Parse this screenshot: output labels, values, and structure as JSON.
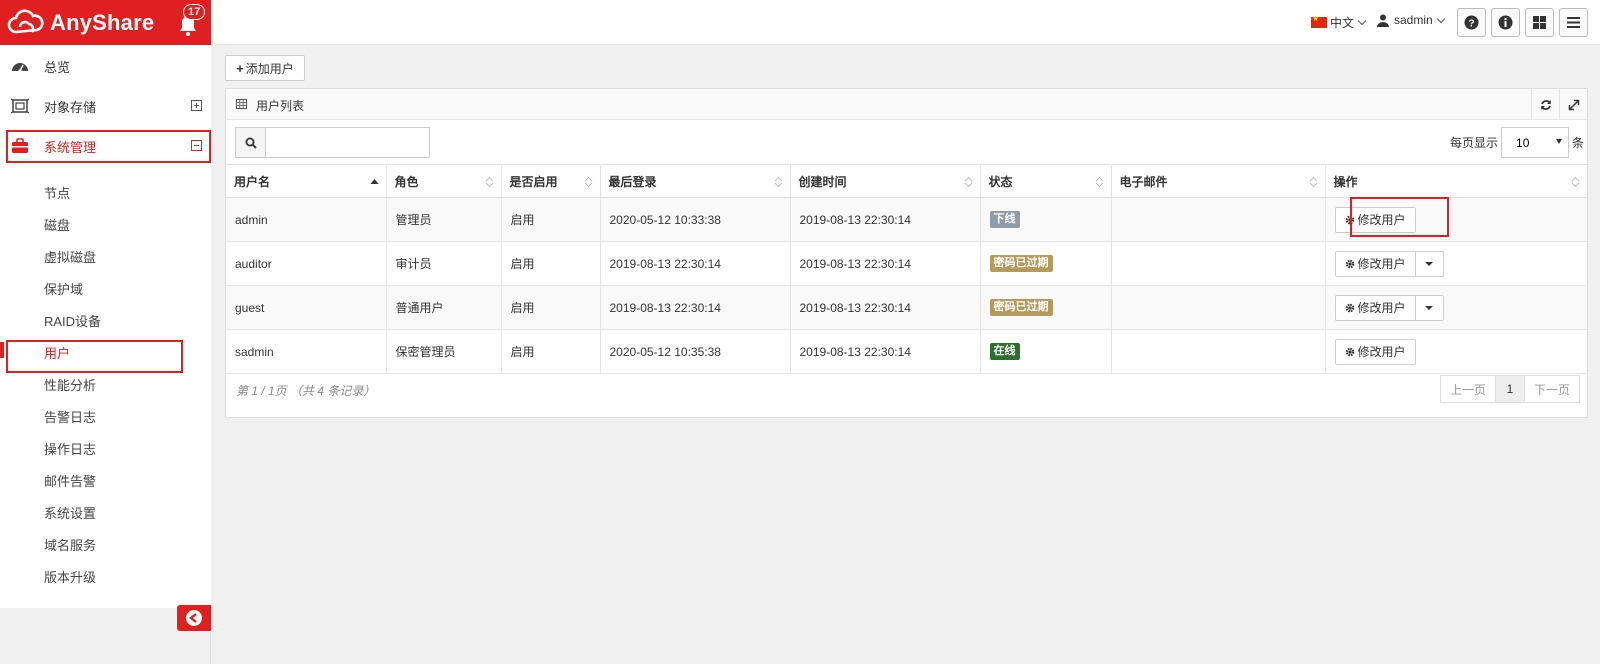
{
  "brand": {
    "name": "AnyShare",
    "notification_count": "17"
  },
  "topbar": {
    "language": "中文",
    "username": "sadmin",
    "buttons": [
      "help-icon",
      "info-icon",
      "grid-icon",
      "menu-icon"
    ]
  },
  "sidebar": {
    "items": [
      {
        "label": "总览",
        "icon": "dashboard-icon"
      },
      {
        "label": "对象存储",
        "icon": "storage-icon",
        "expand": "plus"
      },
      {
        "label": "系统管理",
        "icon": "briefcase-icon",
        "expand": "minus"
      }
    ],
    "sub_items": [
      "节点",
      "磁盘",
      "虚拟磁盘",
      "保护域",
      "RAID设备",
      "用户",
      "性能分析",
      "告警日志",
      "操作日志",
      "邮件告警",
      "系统设置",
      "域名服务",
      "版本升级"
    ],
    "active_sub": "用户"
  },
  "main": {
    "add_user_label": "添加用户",
    "panel_title": "用户列表",
    "search": {
      "value": "",
      "placeholder": ""
    },
    "per_page": {
      "prefix": "每页显示",
      "value": "10",
      "suffix": "条",
      "options": [
        "10"
      ]
    },
    "columns": [
      "用户名",
      "角色",
      "是否启用",
      "最后登录",
      "创建时间",
      "状态",
      "电子邮件",
      "操作"
    ],
    "rows": [
      {
        "username": "admin",
        "role": "管理员",
        "enabled": "启用",
        "last_login": "2020-05-12 10:33:38",
        "created": "2019-08-13 22:30:14",
        "status": "下线",
        "status_color": "#8f9ca6",
        "email": "",
        "action": "修改用户",
        "dropdown": false
      },
      {
        "username": "auditor",
        "role": "审计员",
        "enabled": "启用",
        "last_login": "2019-08-13 22:30:14",
        "created": "2019-08-13 22:30:14",
        "status": "密码已过期",
        "status_color": "#b59a5c",
        "email": "",
        "action": "修改用户",
        "dropdown": true
      },
      {
        "username": "guest",
        "role": "普通用户",
        "enabled": "启用",
        "last_login": "2019-08-13 22:30:14",
        "created": "2019-08-13 22:30:14",
        "status": "密码已过期",
        "status_color": "#b59a5c",
        "email": "",
        "action": "修改用户",
        "dropdown": true
      },
      {
        "username": "sadmin",
        "role": "保密管理员",
        "enabled": "启用",
        "last_login": "2020-05-12 10:35:38",
        "created": "2019-08-13 22:30:14",
        "status": "在线",
        "status_color": "#2f6e2f",
        "email": "",
        "action": "修改用户",
        "dropdown": false
      }
    ],
    "pagination": {
      "info": "第 1 / 1页 （共 4 条记录）",
      "prev": "上一页",
      "current": "1",
      "next": "下一页"
    }
  },
  "colors": {
    "brand_red": "#e02020"
  }
}
